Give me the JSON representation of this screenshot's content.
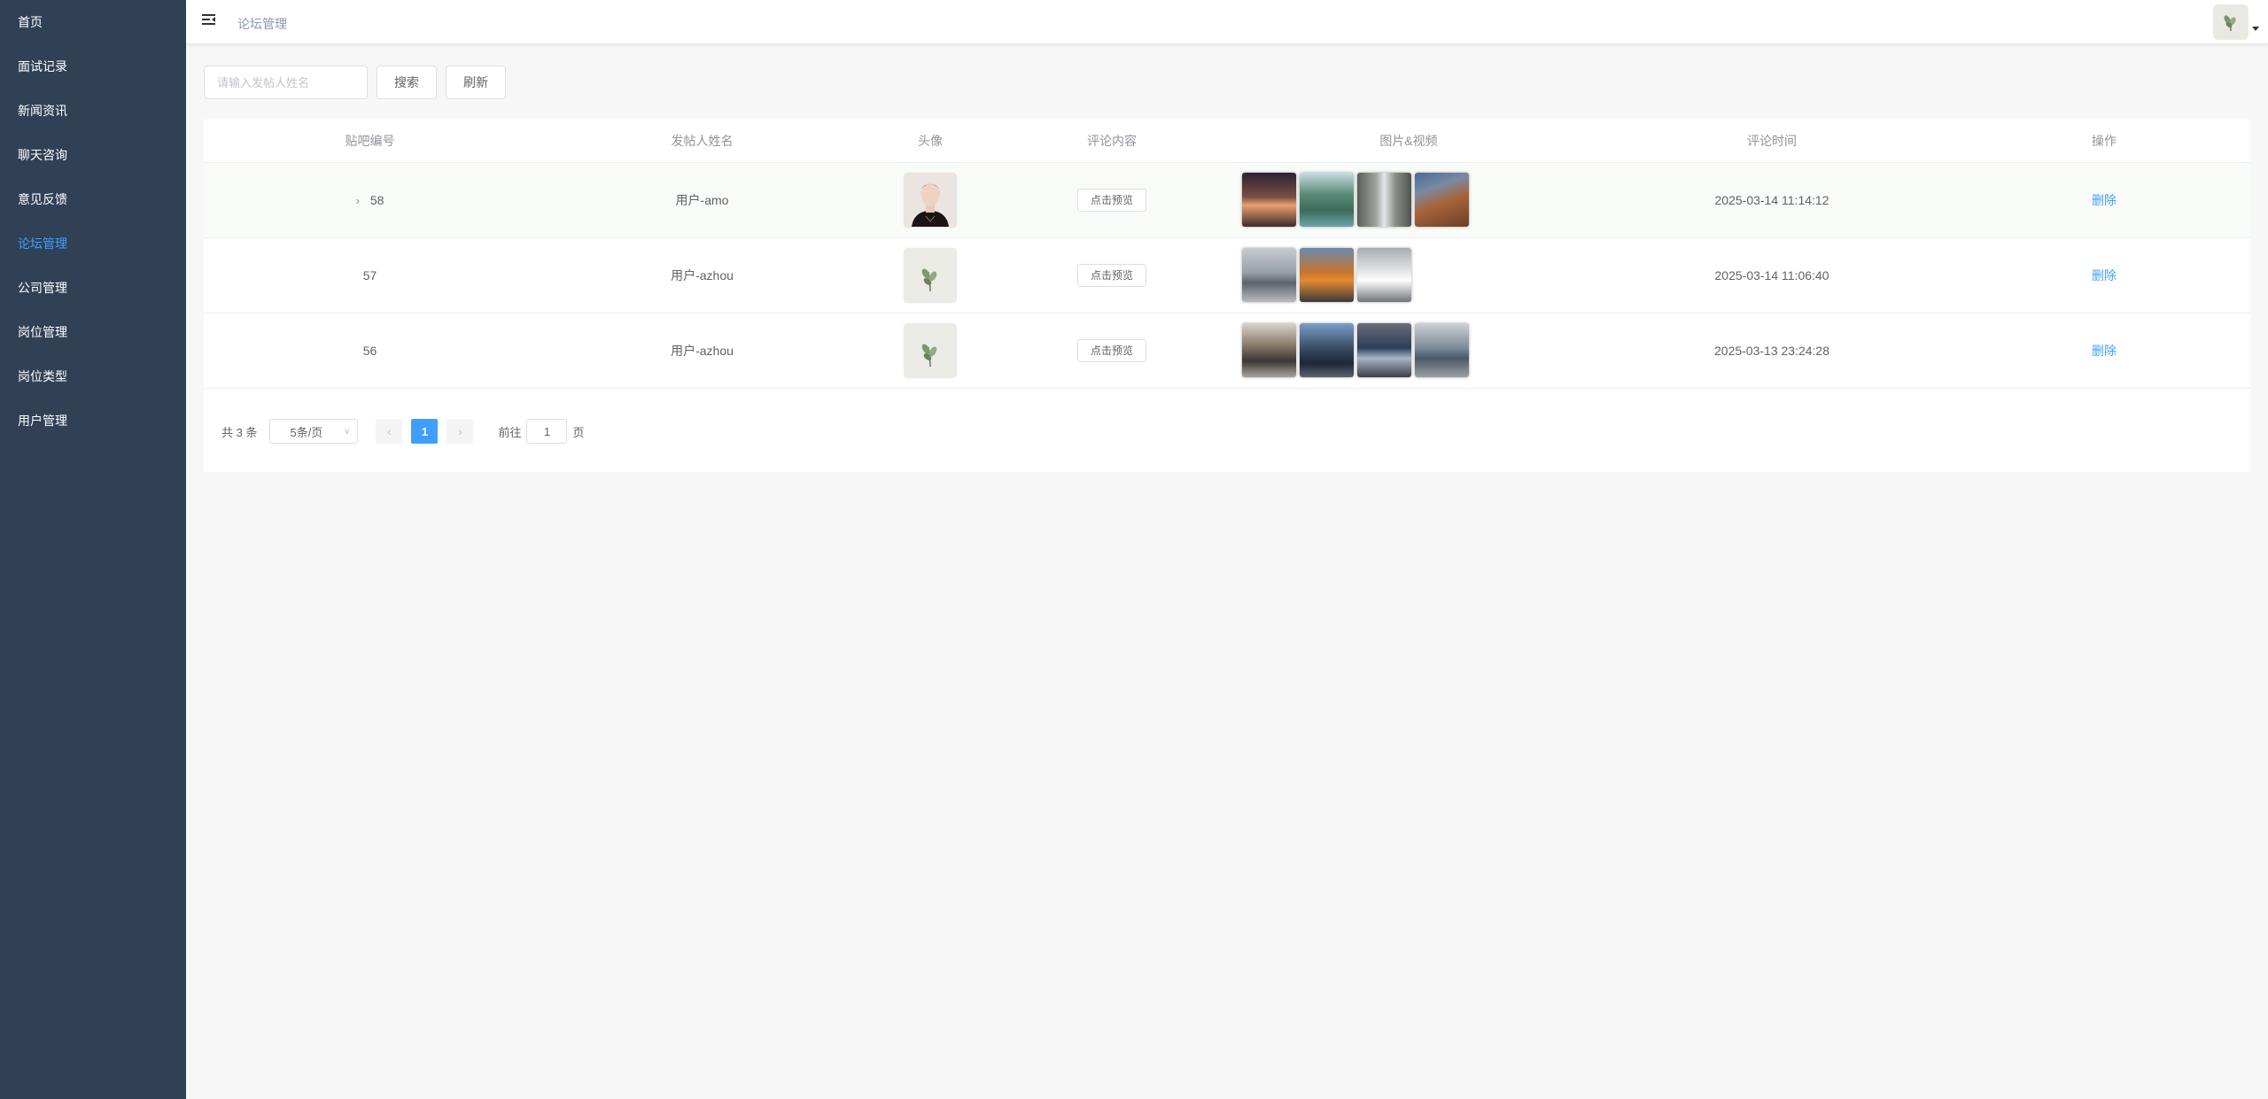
{
  "sidebar": {
    "items": [
      {
        "label": "首页"
      },
      {
        "label": "面试记录"
      },
      {
        "label": "新闻资讯"
      },
      {
        "label": "聊天咨询"
      },
      {
        "label": "意见反馈"
      },
      {
        "label": "论坛管理",
        "active": true
      },
      {
        "label": "公司管理"
      },
      {
        "label": "岗位管理"
      },
      {
        "label": "岗位类型"
      },
      {
        "label": "用户管理"
      }
    ]
  },
  "header": {
    "breadcrumb": "论坛管理",
    "menu_icon": "hamburger-fold-icon",
    "avatar_icon": "user-avatar"
  },
  "search": {
    "placeholder": "请输入发帖人姓名",
    "search_label": "搜索",
    "refresh_label": "刷新"
  },
  "table": {
    "columns": [
      "贴吧编号",
      "发帖人姓名",
      "头像",
      "评论内容",
      "图片&视频",
      "评论时间",
      "操作"
    ],
    "rows": [
      {
        "id": "58",
        "name": "用户-amo",
        "avatar": "portrait",
        "content_btn": "点击预览",
        "media": [
          "sunset",
          "mountain-lake",
          "waterfall",
          "cliff"
        ],
        "time": "2025-03-14 11:14:12",
        "action": "删除",
        "expandable": true
      },
      {
        "id": "57",
        "name": "用户-azhou",
        "avatar": "plant",
        "content_btn": "点击预览",
        "media": [
          "car-silver",
          "car-orange",
          "car-white"
        ],
        "time": "2025-03-14 11:06:40",
        "action": "删除",
        "expandable": false
      },
      {
        "id": "56",
        "name": "用户-azhou",
        "avatar": "plant",
        "content_btn": "点击预览",
        "media": [
          "car-grey",
          "car-blue",
          "car-bmw",
          "car-street"
        ],
        "time": "2025-03-13 23:24:28",
        "action": "删除",
        "expandable": false
      }
    ]
  },
  "pagination": {
    "total": "共 3 条",
    "page_size": "5条/页",
    "current_page": "1",
    "goto_label": "前往",
    "goto_value": "1",
    "page_suffix": "页"
  },
  "colors": {
    "sidebar_bg": "#304156",
    "accent": "#409eff"
  }
}
